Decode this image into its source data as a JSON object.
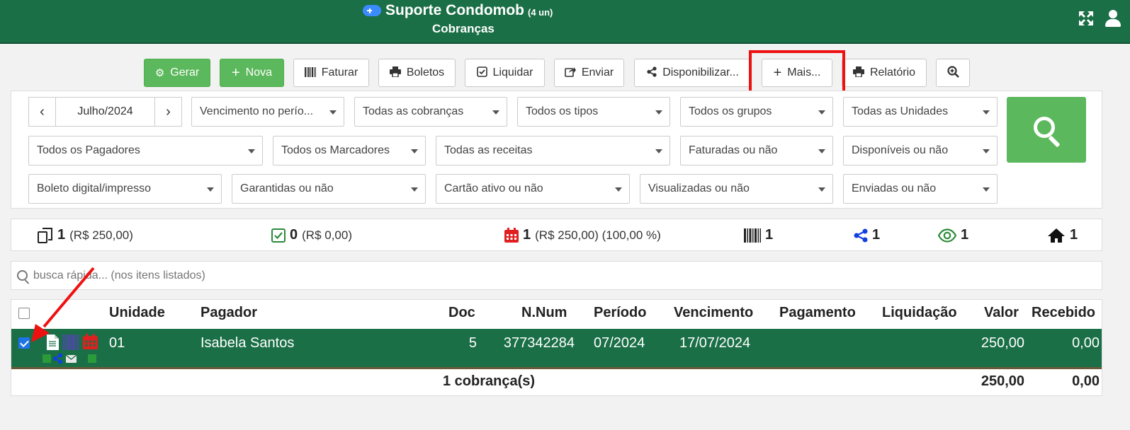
{
  "header": {
    "title": "Suporte Condomob",
    "units": "(4 un)",
    "subtitle": "Cobranças"
  },
  "toolbar": {
    "gerar": "Gerar",
    "nova": "Nova",
    "faturar": "Faturar",
    "boletos": "Boletos",
    "liquidar": "Liquidar",
    "enviar": "Enviar",
    "disponibilizar": "Disponibilizar...",
    "mais": "Mais...",
    "relatorio": "Relatório"
  },
  "filters": {
    "month": "Julho/2024",
    "vencimento": "Vencimento no perío...",
    "cobrancas": "Todas as cobranças",
    "tipos": "Todos os tipos",
    "grupos": "Todos os grupos",
    "unidades": "Todas as Unidades",
    "pagadores": "Todos os Pagadores",
    "marcadores": "Todos os Marcadores",
    "receitas": "Todas as receitas",
    "faturadas": "Faturadas ou não",
    "disponiveis": "Disponíveis ou não",
    "boleto": "Boleto digital/impresso",
    "garantidas": "Garantidas ou não",
    "cartao": "Cartão ativo ou não",
    "visualizadas": "Visualizadas ou não",
    "enviadas": "Enviadas ou não"
  },
  "summary": {
    "total_count": "1",
    "total_value": "(R$ 250,00)",
    "paid_count": "0",
    "paid_value": "(R$ 0,00)",
    "due_count": "1",
    "due_value": "(R$ 250,00) (100,00 %)",
    "barcode_count": "1",
    "shared_count": "1",
    "viewed_count": "1",
    "home_count": "1"
  },
  "quicksearch": {
    "placeholder": "busca rápida... (nos itens listados)"
  },
  "table": {
    "headers": {
      "unidade": "Unidade",
      "pagador": "Pagador",
      "doc": "Doc",
      "nnum": "N.Num",
      "periodo": "Período",
      "vencimento": "Vencimento",
      "pagamento": "Pagamento",
      "liquidacao": "Liquidação",
      "valor": "Valor",
      "recebido": "Recebido"
    },
    "rows": [
      {
        "unidade": "01",
        "pagador": "Isabela Santos",
        "doc": "5",
        "nnum": "377342284",
        "periodo": "07/2024",
        "vencimento": "17/07/2024",
        "pagamento": "",
        "liquidacao": "",
        "valor": "250,00",
        "recebido": "0,00",
        "checked": true
      }
    ],
    "footer": {
      "count": "1 cobrança(s)",
      "valor": "250,00",
      "recebido": "0,00"
    }
  },
  "colors": {
    "header_green": "#1a6f46",
    "button_green": "#5cb85c",
    "highlight_red": "#ee1111",
    "due_red": "#e02020",
    "paid_green": "#2a8a3a",
    "share_blue": "#1040e0"
  }
}
